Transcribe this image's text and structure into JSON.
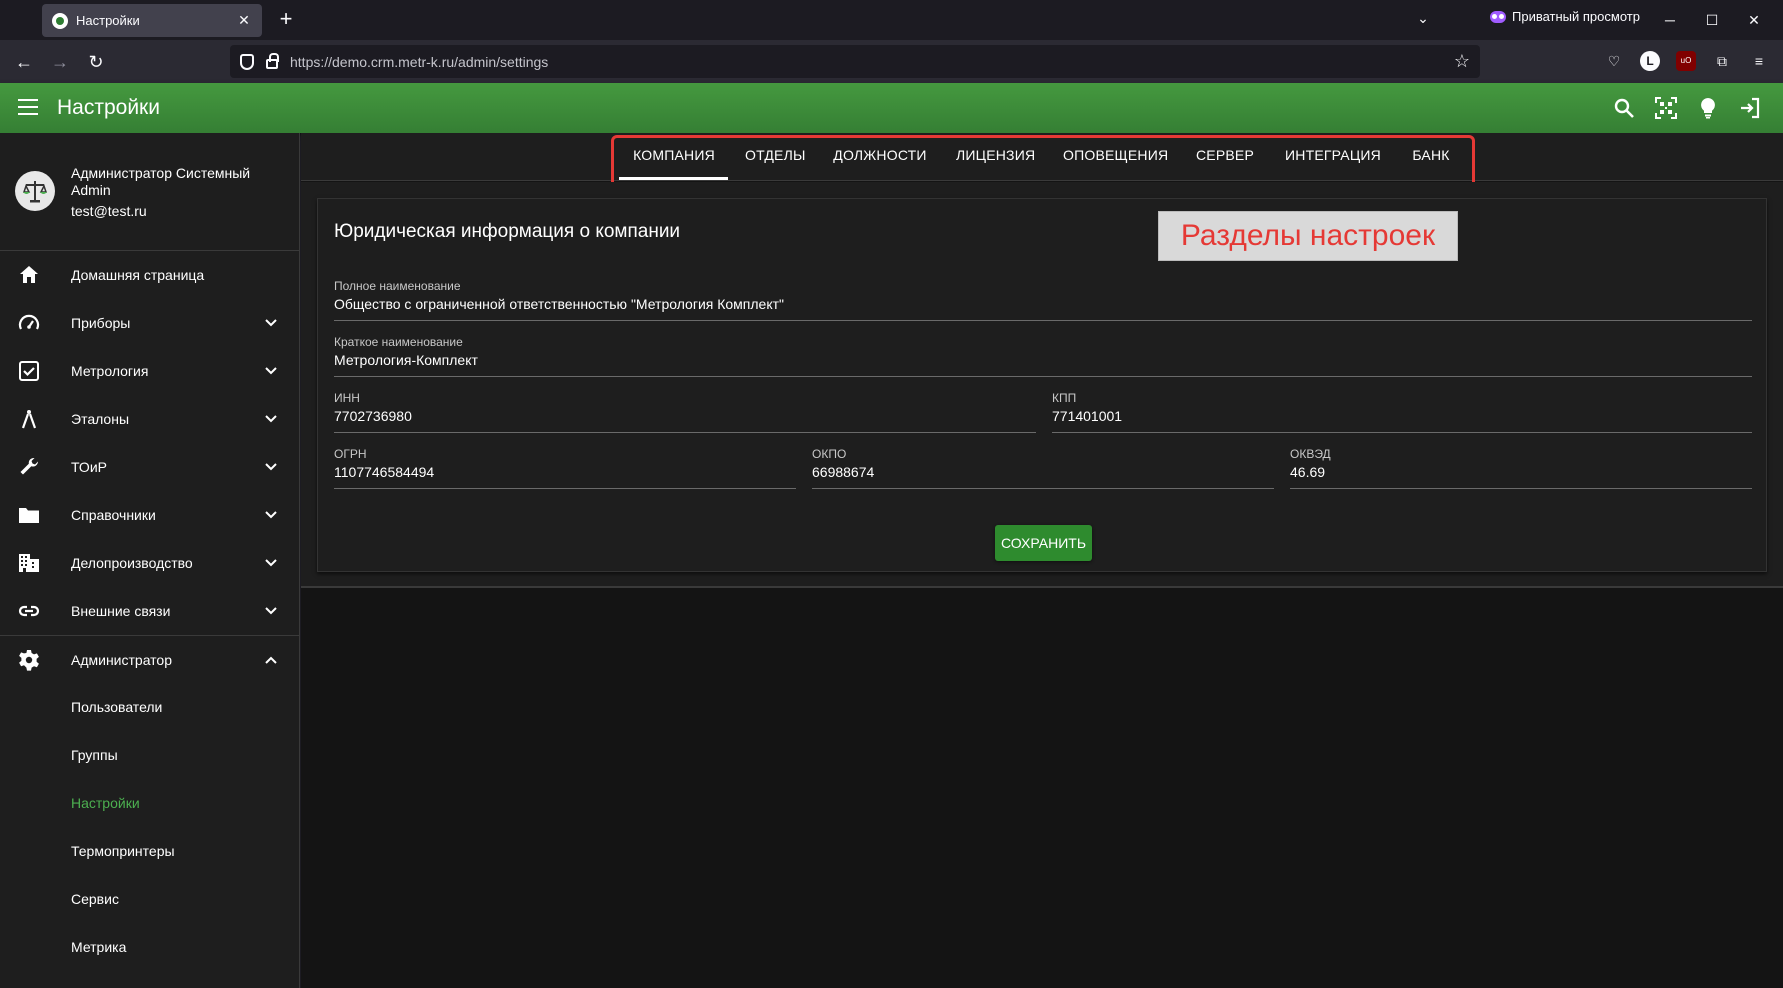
{
  "browser": {
    "tab_title": "Настройки",
    "url": "https://demo.crm.metr-k.ru/admin/settings",
    "private_label": "Приватный просмотр"
  },
  "app": {
    "title": "Настройки",
    "accent_color": "#3d8b3d"
  },
  "user": {
    "name": "Администратор Системный Admin",
    "email": "test@test.ru"
  },
  "sidebar": {
    "items": [
      {
        "label": "Домашняя страница",
        "icon": "home-icon",
        "expandable": false
      },
      {
        "label": "Приборы",
        "icon": "gauge-icon",
        "expandable": true
      },
      {
        "label": "Метрология",
        "icon": "checkbox-icon",
        "expandable": true
      },
      {
        "label": "Эталоны",
        "icon": "compass-icon",
        "expandable": true
      },
      {
        "label": "ТОиР",
        "icon": "wrench-icon",
        "expandable": true
      },
      {
        "label": "Справочники",
        "icon": "folder-icon",
        "expandable": true
      },
      {
        "label": "Делопроизводство",
        "icon": "building-icon",
        "expandable": true
      },
      {
        "label": "Внешние связи",
        "icon": "link-icon",
        "expandable": true
      },
      {
        "label": "Администратор",
        "icon": "gear-icon",
        "expandable": true,
        "expanded": true
      }
    ],
    "admin_subitems": [
      {
        "label": "Пользователи",
        "active": false
      },
      {
        "label": "Группы",
        "active": false
      },
      {
        "label": "Настройки",
        "active": true
      },
      {
        "label": "Термопринтеры",
        "active": false
      },
      {
        "label": "Сервис",
        "active": false
      },
      {
        "label": "Метрика",
        "active": false
      }
    ]
  },
  "settings_tabs": [
    {
      "label": "КОМПАНИЯ",
      "active": true
    },
    {
      "label": "ОТДЕЛЫ",
      "active": false
    },
    {
      "label": "ДОЛЖНОСТИ",
      "active": false
    },
    {
      "label": "ЛИЦЕНЗИЯ",
      "active": false
    },
    {
      "label": "ОПОВЕЩЕНИЯ",
      "active": false
    },
    {
      "label": "СЕРВЕР",
      "active": false
    },
    {
      "label": "ИНТЕГРАЦИЯ",
      "active": false
    },
    {
      "label": "БАНК",
      "active": false
    }
  ],
  "callout": "Разделы настроек",
  "form": {
    "title": "Юридическая информация о компании",
    "full_name": {
      "label": "Полное наименование",
      "value": "Общество с ограниченной ответственностью \"Метрология Комплект\""
    },
    "short_name": {
      "label": "Краткое наименование",
      "value": "Метрология-Комплект"
    },
    "inn": {
      "label": "ИНН",
      "value": "7702736980"
    },
    "kpp": {
      "label": "КПП",
      "value": "771401001"
    },
    "ogrn": {
      "label": "ОГРН",
      "value": "1107746584494"
    },
    "okpo": {
      "label": "ОКПО",
      "value": "66988674"
    },
    "okved": {
      "label": "ОКВЭД",
      "value": "46.69"
    },
    "save_label": "СОХРАНИТЬ"
  }
}
